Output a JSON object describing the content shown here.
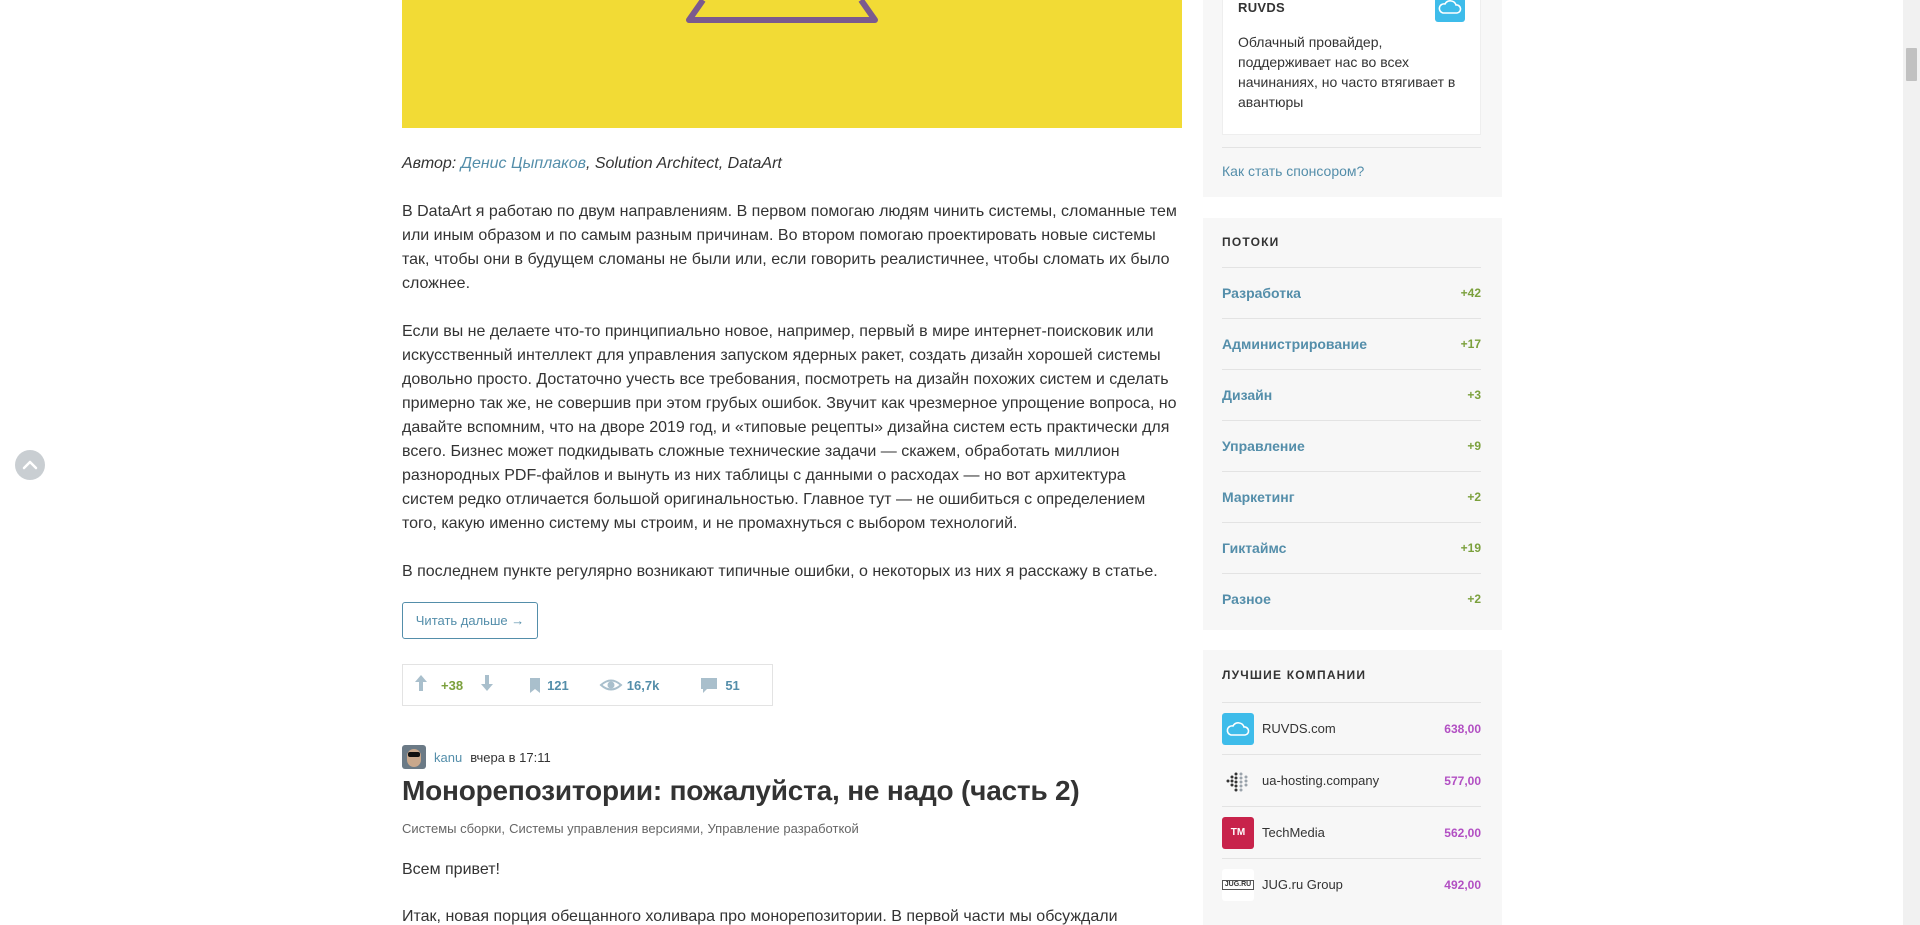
{
  "article": {
    "author_prefix": "Автор: ",
    "author_name": "Денис Цыплаков",
    "author_suffix": ", Solution Architect, DataArt",
    "paragraphs": [
      "В DataArt я работаю по двум направлениям. В первом помогаю людям чинить системы, сломанные тем или иным образом и по самым разным причинам. Во втором помогаю проектировать новые системы так, чтобы они в будущем сломаны не были или, если говорить реалистичнее, чтобы сломать их было сложнее.",
      "Если вы не делаете что-то принципиально новое, например, первый в мире интернет-поисковик или искусственный интеллект для управления запуском ядерных ракет, создать дизайн хорошей системы довольно просто. Достаточно учесть все требования, посмотреть на дизайн похожих систем и сделать примерно так же, не совершив при этом грубых ошибок. Звучит как чрезмерное упрощение вопроса, но давайте вспомним, что на дворе 2019 год, и «типовые рецепты» дизайна систем есть практически для всего. Бизнес может подкидывать сложные технические задачи — скажем, обработать миллион разнородных PDF-файлов и вынуть из них таблицы с данными о расходах — но вот архитектура систем редко отличается большой оригинальностью. Главное тут — не ошибиться с определением того, какую именно систему мы строим, и не промахнуться с выбором технологий.",
      "В последнем пункте регулярно возникают типичные ошибки, о некоторых из них я расскажу в статье."
    ],
    "read_more": "Читать дальше →",
    "stats": {
      "score": "+38",
      "bookmarks": "121",
      "views": "16,7k",
      "comments": "51"
    }
  },
  "next_post": {
    "username": "kanu",
    "time": "вчера в 17:11",
    "title": "Монорепозитории: пожалуйста, не надо (часть 2)",
    "hubs": [
      "Системы сборки,",
      "Системы управления версиями,",
      "Управление разработкой"
    ],
    "paragraphs": [
      "Всем привет!",
      "Итак, новая порция обещанного холивара про монорепозитории. В первой части мы обсуждали"
    ]
  },
  "sidebar": {
    "sponsor": {
      "name": "RUVDS",
      "description": "Облачный провайдер, поддерживает нас во всех начинаниях, но часто втягивает в авантюры",
      "become_sponsor": "Как стать спонсором?"
    },
    "flows": {
      "title": "ПОТОКИ",
      "items": [
        {
          "name": "Разработка",
          "count": "+42"
        },
        {
          "name": "Администрирование",
          "count": "+17"
        },
        {
          "name": "Дизайн",
          "count": "+3"
        },
        {
          "name": "Управление",
          "count": "+9"
        },
        {
          "name": "Маркетинг",
          "count": "+2"
        },
        {
          "name": "Гиктаймс",
          "count": "+19"
        },
        {
          "name": "Разное",
          "count": "+2"
        }
      ]
    },
    "companies": {
      "title": "ЛУЧШИЕ КОМПАНИИ",
      "items": [
        {
          "name": "RUVDS.com",
          "rating": "638,00",
          "logo": "ruvds-logo"
        },
        {
          "name": "ua-hosting.company",
          "rating": "577,00",
          "logo": "ua-hosting-logo"
        },
        {
          "name": "TechMedia",
          "rating": "562,00",
          "logo": "techmedia-logo",
          "logo_text": "TM"
        },
        {
          "name": "JUG.ru Group",
          "rating": "492,00",
          "logo": "jug-logo",
          "logo_text": "JUG.RU"
        }
      ]
    }
  },
  "colors": {
    "link": "#548eaa",
    "score_positive": "#7ba03c",
    "rating": "#b24fc3",
    "hero_background": "#f2db35",
    "sidebar_background": "#f7f7f7"
  }
}
